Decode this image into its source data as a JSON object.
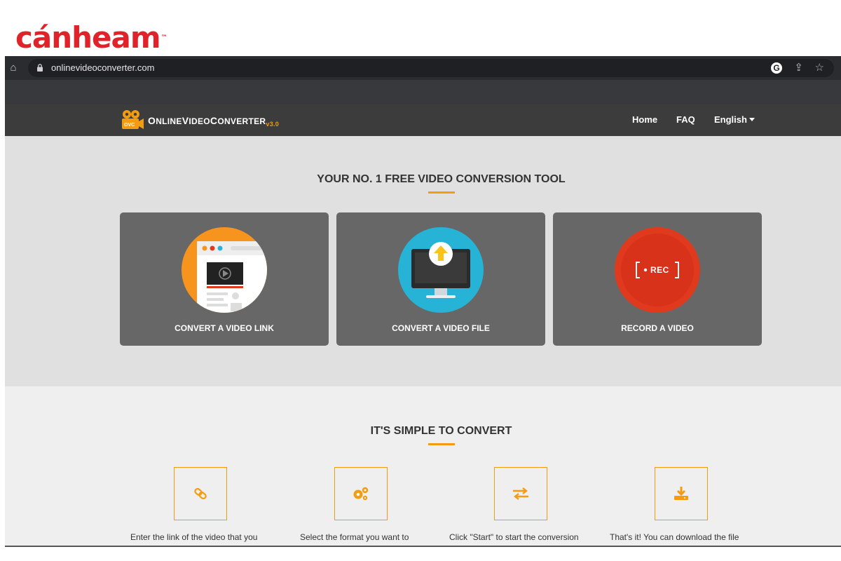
{
  "watermark": {
    "logo_text": "cánheam",
    "tm": "™"
  },
  "browser": {
    "url": "onlinevideoconverter.com",
    "home_icon": "home-icon",
    "lock_icon": "lock-icon",
    "google_icon": "google-icon",
    "share_icon": "share-icon",
    "bookmark_icon": "star-icon"
  },
  "site_nav": {
    "brand_prefix": "O",
    "brand_name_parts": [
      "NLINE",
      "V",
      "IDEO",
      "C",
      "ONVERTER"
    ],
    "brand_version": "v3.0",
    "links": [
      "Home",
      "FAQ"
    ],
    "language": "English"
  },
  "hero": {
    "title": "YOUR NO. 1 FREE VIDEO CONVERSION TOOL",
    "cards": [
      {
        "label": "CONVERT A VIDEO LINK",
        "icon": "browser-video-icon",
        "color": "#f7941d"
      },
      {
        "label": "CONVERT A VIDEO FILE",
        "icon": "monitor-upload-icon",
        "color": "#26b3d6"
      },
      {
        "label": "RECORD A VIDEO",
        "icon": "record-icon",
        "color": "#e03a1e",
        "rec_text": "REC"
      }
    ]
  },
  "steps": {
    "title": "IT'S SIMPLE TO CONVERT",
    "items": [
      {
        "icon": "link-icon",
        "text": "Enter the link of the video that you"
      },
      {
        "icon": "gears-icon",
        "text": "Select the format you want to"
      },
      {
        "icon": "exchange-icon",
        "text": "Click \"Start\" to start the conversion"
      },
      {
        "icon": "download-icon",
        "text": "That's it! You can download the file"
      }
    ]
  },
  "colors": {
    "accent": "#f39c12",
    "nav_bg": "#3c3c3c",
    "card_bg": "#676767"
  }
}
